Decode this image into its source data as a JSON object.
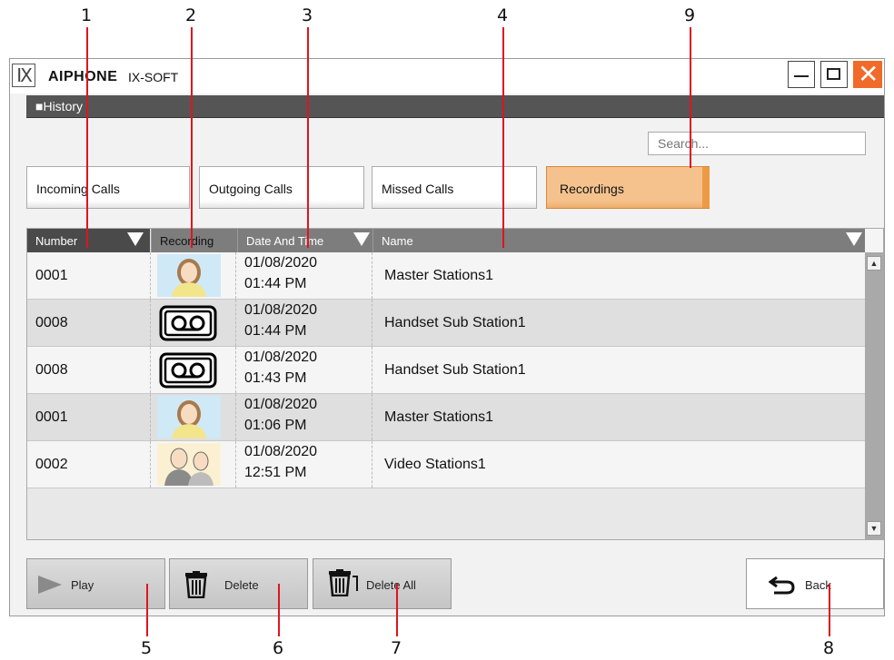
{
  "callouts": [
    "1",
    "2",
    "3",
    "4",
    "5",
    "6",
    "7",
    "8",
    "9"
  ],
  "window": {
    "brand": "AIPHONE",
    "product": "IX-SOFT",
    "logo": "IX"
  },
  "section": {
    "title": "■History"
  },
  "search": {
    "placeholder": "Search..."
  },
  "tabs": [
    {
      "label": "Incoming Calls"
    },
    {
      "label": "Outgoing Calls"
    },
    {
      "label": "Missed Calls"
    },
    {
      "label": "Recordings",
      "active": true
    }
  ],
  "table": {
    "columns": [
      "Number",
      "Recording",
      "Date And Time",
      "Name"
    ],
    "rows": [
      {
        "number": "0001",
        "recording": "female-avatar-icon",
        "date": "01/08/2020",
        "time": "01:44 PM",
        "name": "Master Stations1"
      },
      {
        "number": "0008",
        "recording": "voicemail-tape-icon",
        "date": "01/08/2020",
        "time": "01:44 PM",
        "name": "Handset Sub Station1"
      },
      {
        "number": "0008",
        "recording": "voicemail-tape-icon",
        "date": "01/08/2020",
        "time": "01:43 PM",
        "name": "Handset Sub Station1"
      },
      {
        "number": "0001",
        "recording": "female-avatar-icon",
        "date": "01/08/2020",
        "time": "01:06 PM",
        "name": "Master Stations1"
      },
      {
        "number": "0002",
        "recording": "couple-avatar-icon",
        "date": "01/08/2020",
        "time": "12:51 PM",
        "name": "Video Stations1"
      }
    ]
  },
  "buttons": {
    "play": "Play",
    "delete": "Delete",
    "delete_all": "Delete All",
    "back": "Back"
  },
  "colors": {
    "active_tab": "#f5c28d",
    "close_button": "#f06a2a",
    "callout_line": "#e0141e",
    "section_bar": "#555555"
  }
}
